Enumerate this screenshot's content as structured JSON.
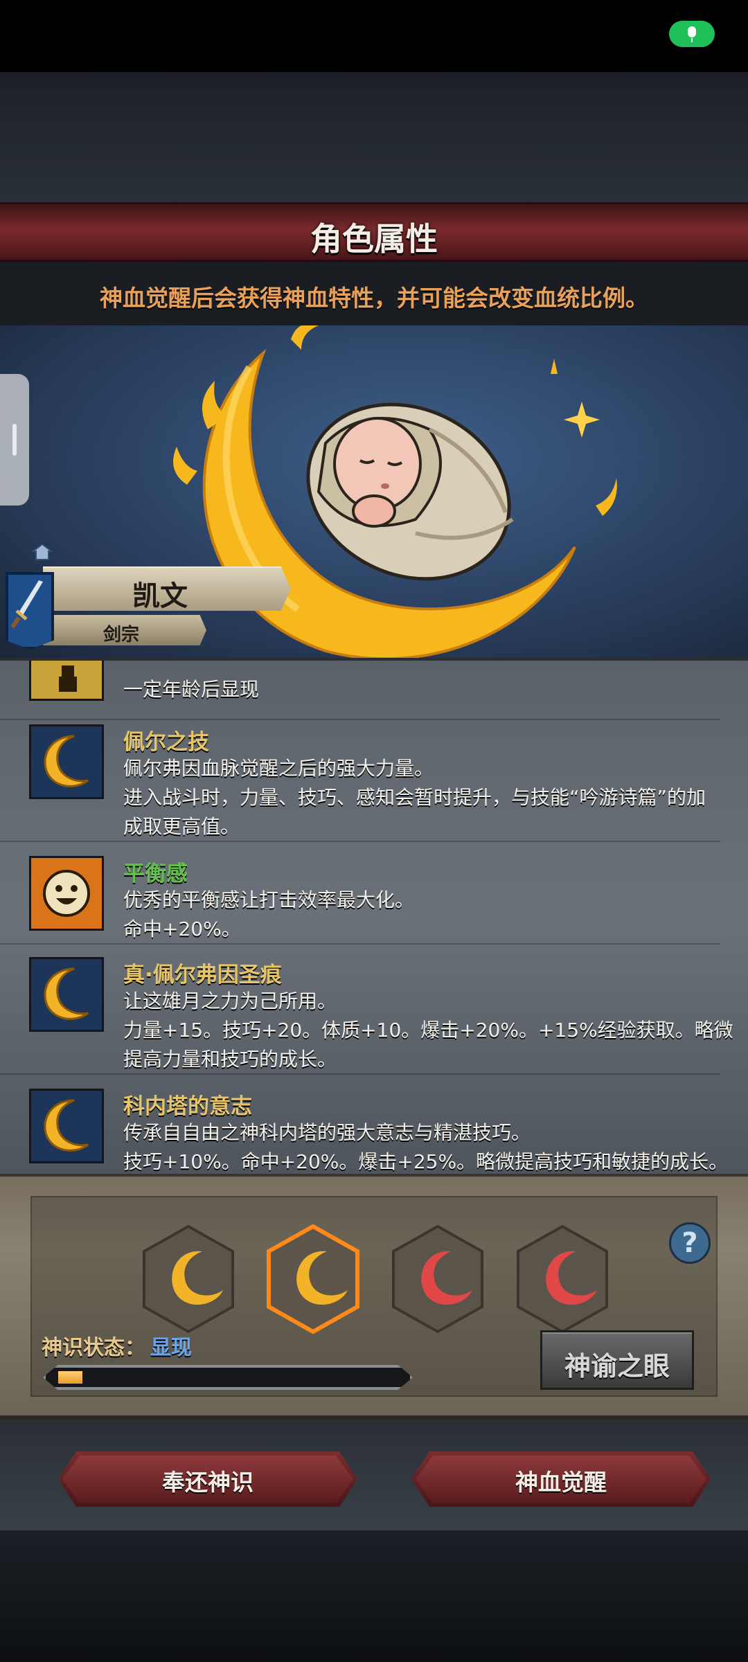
{
  "header": {
    "title": "角色属性",
    "subtitle": "神血觉醒后会获得神血特性，并可能会改变血统比例。"
  },
  "character": {
    "name": "凯文",
    "class": "剑宗",
    "class_icon": "sword-icon"
  },
  "traits": [
    {
      "name": "",
      "lines": [
        "一定年龄后显现"
      ],
      "icon": "lock-icon",
      "name_color": "#e6c56a"
    },
    {
      "name": "佩尔之技",
      "lines": [
        "佩尔弗因血脉觉醒之后的强大力量。",
        "进入战斗时，力量、技巧、感知会暂时提升，与技能“吟游诗篇”的加",
        "成取更高值。"
      ],
      "icon": "golden-moon-icon",
      "name_color": "#e6c56a"
    },
    {
      "name": "平衡感",
      "lines": [
        "优秀的平衡感让打击效率最大化。",
        "命中+20%。"
      ],
      "icon": "smiley-sun-icon",
      "name_color": "#63c24a"
    },
    {
      "name": "真·佩尔弗因圣痕",
      "lines": [
        "让这雄月之力为己所用。",
        "力量+15。技巧+20。体质+10。爆击+20%。+15%经验获取。略微",
        "提高力量和技巧的成长。"
      ],
      "icon": "golden-moon-icon",
      "name_color": "#e6c56a"
    },
    {
      "name": "科内塔的意志",
      "lines": [
        "传承自自由之神科内塔的强大意志与精湛技巧。",
        "技巧+10%。命中+20%。爆击+25%。略微提高技巧和敏捷的成长。"
      ],
      "icon": "golden-moon-icon",
      "name_color": "#e6c56a"
    }
  ],
  "awakening": {
    "slots": [
      "gold-crescent",
      "gold-crescent-selected",
      "red-crescent",
      "red-crescent"
    ],
    "state_label": "神识状态：",
    "state_value": "显现",
    "progress": 0.07,
    "oracle_button": "神谕之眼",
    "help": "?"
  },
  "buttons": {
    "return": "奉还神识",
    "awaken": "神血觉醒"
  },
  "colors": {
    "accent_red": "#7a2a2c",
    "gold": "#f2b328",
    "crescent_red": "#e04848",
    "state_blue": "#6aa6f0"
  }
}
